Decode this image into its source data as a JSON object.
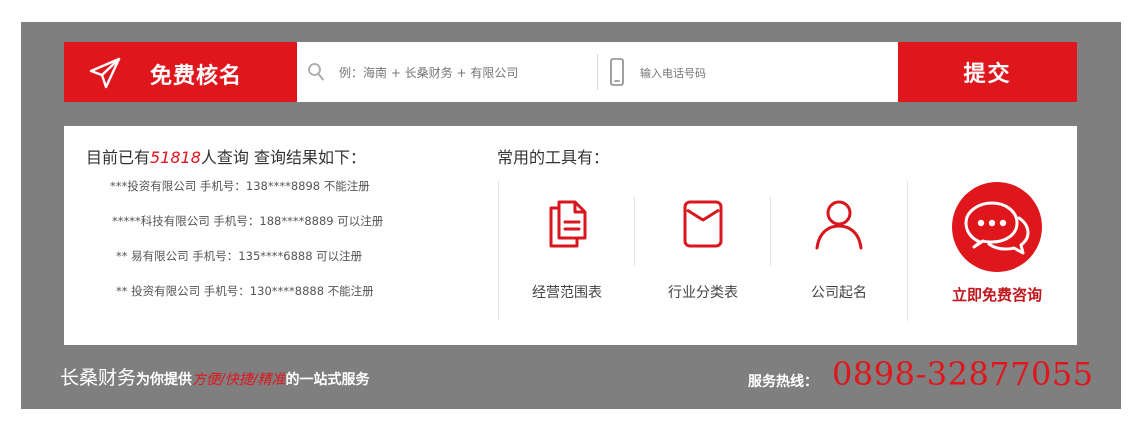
{
  "header": {
    "brand_title": "免费核名",
    "search_placeholder": "例：海南 + 长桑财务 + 有限公司",
    "phone_placeholder": "输入电话号码",
    "submit_label": "提交"
  },
  "query": {
    "prefix": "目前已有",
    "count": "51818",
    "suffix": "人查询 查询结果如下：",
    "results": [
      "***投资有限公司 手机号：138****8898 不能注册",
      "*****科技有限公司 手机号：188****8889 可以注册",
      "** 易有限公司 手机号：135****6888 可以注册",
      "** 投资有限公司 手机号：130****8888 不能注册"
    ]
  },
  "tools": {
    "title": "常用的工具有：",
    "items": [
      {
        "label": "经营范围表",
        "icon": "documents-icon"
      },
      {
        "label": "行业分类表",
        "icon": "envelope-icon"
      },
      {
        "label": "公司起名",
        "icon": "user-icon"
      }
    ],
    "consult_label": "立即免费咨询",
    "consult_icon": "chat-bubbles-icon"
  },
  "footer": {
    "brand": "长桑财务",
    "text_before": "为你提供",
    "highlight": "方便/快捷/精准",
    "text_after": "的一站式服务",
    "hotline_label": "服务热线：",
    "hotline_number": "0898-32877055"
  },
  "colors": {
    "accent_red": "#e0161d",
    "panel_gray": "#7f7f7f"
  }
}
